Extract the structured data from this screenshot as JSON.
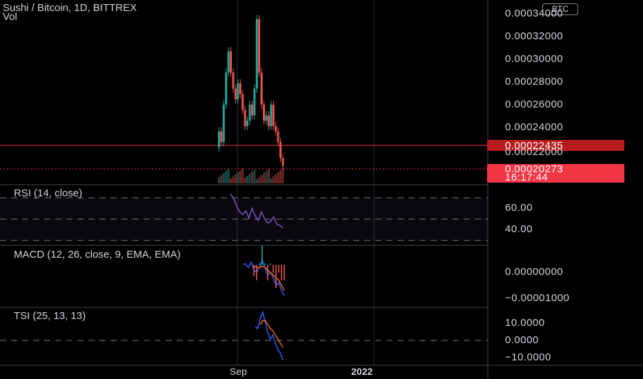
{
  "chart": {
    "title": "Sushi / Bitcoin, 1D, BITTREX",
    "volume_label": "Vol",
    "currency_badge": "BTC",
    "price_axis": [
      "0.00034000",
      "0.00032000",
      "0.00030000",
      "0.00028000",
      "0.00026000",
      "0.00024000",
      "0.00022000"
    ],
    "last_price": "0.00022435",
    "current_price": "0.00020273",
    "countdown": "16:17:44",
    "time_axis": [
      "Sep",
      "2022"
    ],
    "colors": {
      "up": "#26a69a",
      "down": "#ef5350",
      "rsi": "#7e57c2",
      "macd": "#2962ff",
      "signal": "#ff6d00",
      "price_line": "#f23645"
    }
  },
  "rsi": {
    "label": "RSI (14, close)",
    "axis": [
      "60.00",
      "40.00"
    ]
  },
  "macd": {
    "label": "MACD (12, 26, close, 9, EMA, EMA)",
    "axis": [
      "0.00000000",
      "−0.00001000"
    ]
  },
  "tsi": {
    "label": "TSI (25, 13, 13)",
    "axis": [
      "10.0000",
      "0.0000",
      "−10.0000"
    ]
  },
  "chart_data": [
    {
      "type": "line",
      "title": "Sushi / Bitcoin, 1D, BITTREX",
      "ylim": [
        0.0002,
        0.000345
      ],
      "series": [
        {
          "name": "Sushi / Bitcoin",
          "values": [
            0.00022,
            0.000235,
            0.000225,
            0.00026,
            0.00029,
            0.00031,
            0.00029,
            0.000275,
            0.000265,
            0.00028,
            0.00027,
            0.000255,
            0.00024,
            0.000245,
            0.00026,
            0.00025,
            0.000275,
            0.00034,
            0.00029,
            0.00026,
            0.000245,
            0.00025,
            0.00024,
            0.00026,
            0.00024,
            0.000235,
            0.000225,
            0.00021,
            0.000203
          ]
        }
      ]
    },
    {
      "type": "line",
      "title": "RSI (14, close)",
      "ylim": [
        30,
        75
      ],
      "series": [
        {
          "name": "RSI (14, close)",
          "values": [
            70,
            66,
            60,
            55,
            53,
            56,
            50,
            58,
            52,
            48,
            55,
            50,
            46,
            47,
            51,
            45,
            44,
            42
          ]
        }
      ]
    },
    {
      "type": "line",
      "title": "MACD (12, 26, close, 9, EMA, EMA)",
      "ylim": [
        -1.6e-05,
        6e-06
      ],
      "series": [
        {
          "name": "MACD",
          "values": [
            2e-07,
            4e-07,
            -1e-06,
            1e-06,
            -2e-06,
            -3e-06,
            -1e-06,
            2e-06,
            -1e-06,
            -4e-06,
            -3e-06,
            -5e-06,
            -8e-06,
            -7e-06,
            -1e-05,
            -1.2e-05
          ]
        },
        {
          "name": "Signal",
          "values": [
            null,
            null,
            null,
            null,
            -5e-07,
            -1e-06,
            -1e-06,
            -5e-07,
            -1e-06,
            -2e-06,
            -3e-06,
            -4e-06,
            -5e-06,
            -6e-06,
            -8e-06,
            -1e-05
          ]
        }
      ]
    },
    {
      "type": "line",
      "title": "TSI (25, 13, 13)",
      "ylim": [
        -12,
        14
      ],
      "series": [
        {
          "name": "TSI",
          "values": [
            6,
            5,
            10,
            13,
            8,
            3,
            0,
            2,
            -2,
            -5,
            -7,
            -10
          ]
        },
        {
          "name": "TSI signal",
          "values": [
            null,
            null,
            7,
            9,
            9,
            7,
            5,
            4,
            2,
            0,
            -2,
            -4
          ]
        }
      ]
    }
  ]
}
